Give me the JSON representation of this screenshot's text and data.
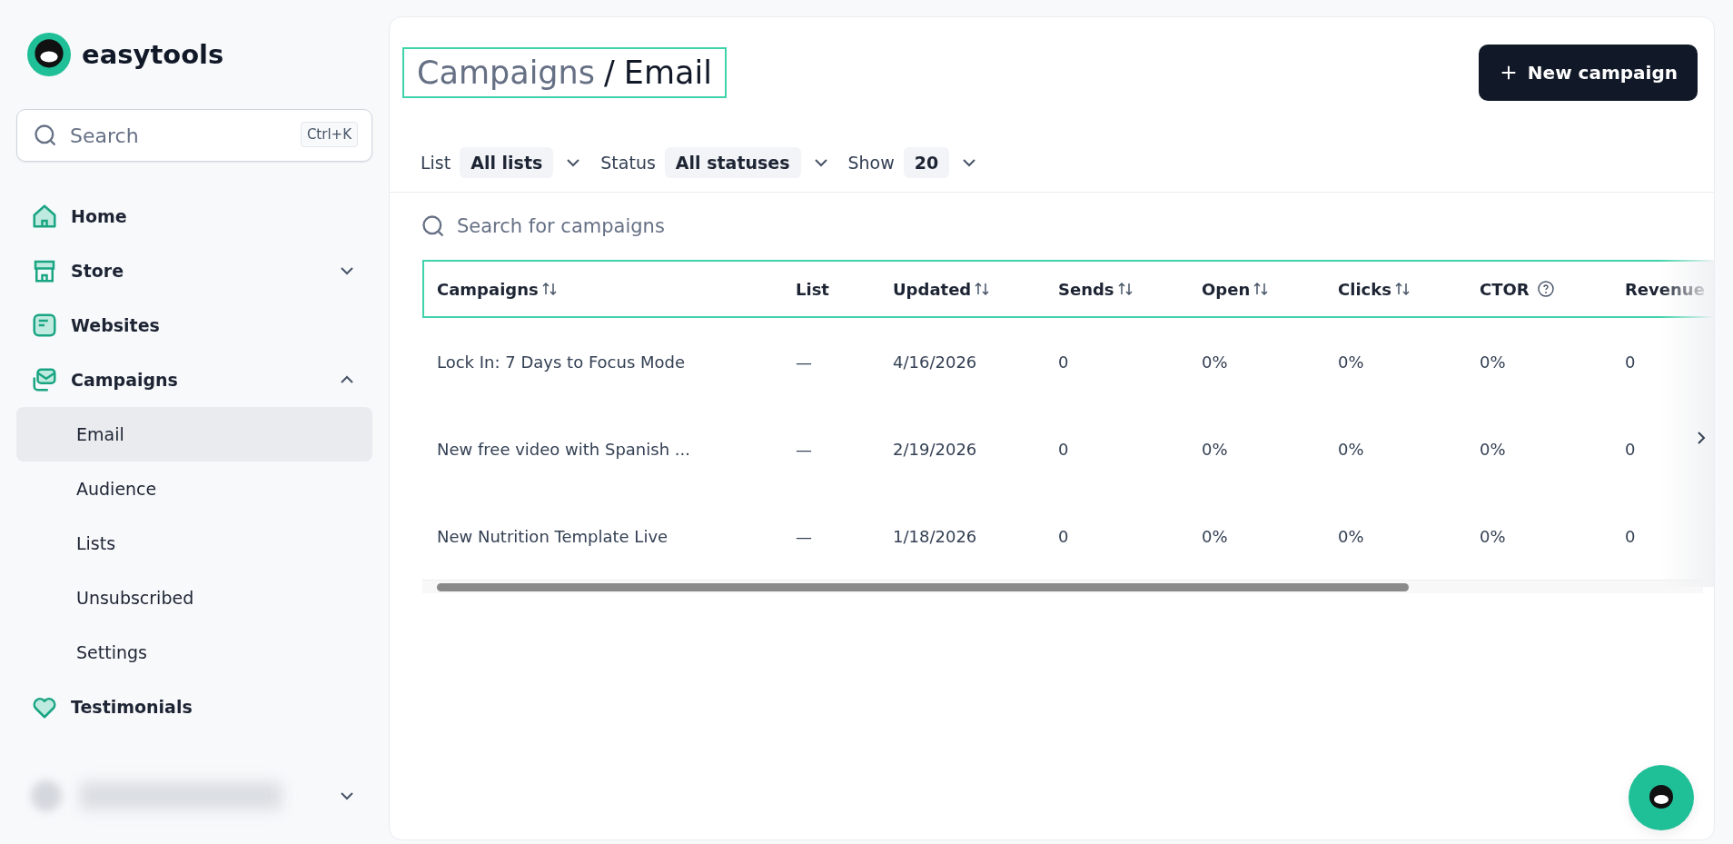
{
  "brand": {
    "name": "easytools"
  },
  "search": {
    "placeholder": "Search",
    "shortcut": "Ctrl+K"
  },
  "nav": [
    {
      "label": "Home"
    },
    {
      "label": "Store",
      "expanded": false
    },
    {
      "label": "Websites"
    },
    {
      "label": "Campaigns",
      "expanded": true,
      "children": [
        {
          "label": "Email",
          "selected": true
        },
        {
          "label": "Audience",
          "selected": false
        },
        {
          "label": "Lists",
          "selected": false
        },
        {
          "label": "Unsubscribed",
          "selected": false
        },
        {
          "label": "Settings",
          "selected": false
        }
      ]
    },
    {
      "label": "Testimonials"
    }
  ],
  "breadcrumb": {
    "parent": "Campaigns",
    "separator": "/",
    "current": "Email"
  },
  "new_button": "New campaign",
  "filters": [
    {
      "label": "List",
      "value": "All lists"
    },
    {
      "label": "Status",
      "value": "All statuses"
    },
    {
      "label": "Show",
      "value": "20"
    }
  ],
  "table_search": {
    "placeholder": "Search for campaigns"
  },
  "table": {
    "columns": [
      {
        "label": "Campaigns",
        "sort": true,
        "help": false
      },
      {
        "label": "List",
        "sort": false,
        "help": false
      },
      {
        "label": "Updated",
        "sort": true,
        "help": false
      },
      {
        "label": "Sends",
        "sort": true,
        "help": false
      },
      {
        "label": "Open",
        "sort": true,
        "help": false
      },
      {
        "label": "Clicks",
        "sort": true,
        "help": false
      },
      {
        "label": "CTOR",
        "sort": false,
        "help": true
      },
      {
        "label": "Revenue"
      }
    ],
    "rows": [
      [
        "Lock In: 7 Days to Focus Mode",
        "—",
        "4/16/2026",
        "0",
        "0%",
        "0%",
        "0%",
        "0"
      ],
      [
        "New free video with Spanish ...",
        "—",
        "2/19/2026",
        "0",
        "0%",
        "0%",
        "0%",
        "0"
      ],
      [
        "New Nutrition Template Live",
        "—",
        "1/18/2026",
        "0",
        "0%",
        "0%",
        "0%",
        "0"
      ]
    ]
  }
}
